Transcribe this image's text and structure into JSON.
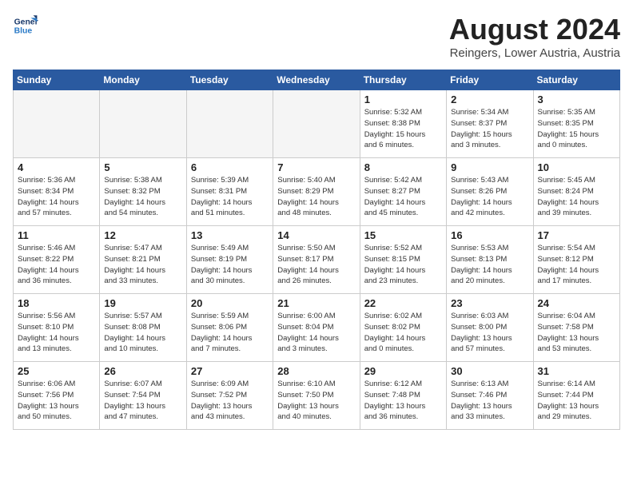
{
  "header": {
    "logo_line1": "General",
    "logo_line2": "Blue",
    "month": "August 2024",
    "location": "Reingers, Lower Austria, Austria"
  },
  "weekdays": [
    "Sunday",
    "Monday",
    "Tuesday",
    "Wednesday",
    "Thursday",
    "Friday",
    "Saturday"
  ],
  "weeks": [
    [
      {
        "num": "",
        "info": "",
        "empty": true
      },
      {
        "num": "",
        "info": "",
        "empty": true
      },
      {
        "num": "",
        "info": "",
        "empty": true
      },
      {
        "num": "",
        "info": "",
        "empty": true
      },
      {
        "num": "1",
        "info": "Sunrise: 5:32 AM\nSunset: 8:38 PM\nDaylight: 15 hours\nand 6 minutes."
      },
      {
        "num": "2",
        "info": "Sunrise: 5:34 AM\nSunset: 8:37 PM\nDaylight: 15 hours\nand 3 minutes."
      },
      {
        "num": "3",
        "info": "Sunrise: 5:35 AM\nSunset: 8:35 PM\nDaylight: 15 hours\nand 0 minutes."
      }
    ],
    [
      {
        "num": "4",
        "info": "Sunrise: 5:36 AM\nSunset: 8:34 PM\nDaylight: 14 hours\nand 57 minutes."
      },
      {
        "num": "5",
        "info": "Sunrise: 5:38 AM\nSunset: 8:32 PM\nDaylight: 14 hours\nand 54 minutes."
      },
      {
        "num": "6",
        "info": "Sunrise: 5:39 AM\nSunset: 8:31 PM\nDaylight: 14 hours\nand 51 minutes."
      },
      {
        "num": "7",
        "info": "Sunrise: 5:40 AM\nSunset: 8:29 PM\nDaylight: 14 hours\nand 48 minutes."
      },
      {
        "num": "8",
        "info": "Sunrise: 5:42 AM\nSunset: 8:27 PM\nDaylight: 14 hours\nand 45 minutes."
      },
      {
        "num": "9",
        "info": "Sunrise: 5:43 AM\nSunset: 8:26 PM\nDaylight: 14 hours\nand 42 minutes."
      },
      {
        "num": "10",
        "info": "Sunrise: 5:45 AM\nSunset: 8:24 PM\nDaylight: 14 hours\nand 39 minutes."
      }
    ],
    [
      {
        "num": "11",
        "info": "Sunrise: 5:46 AM\nSunset: 8:22 PM\nDaylight: 14 hours\nand 36 minutes."
      },
      {
        "num": "12",
        "info": "Sunrise: 5:47 AM\nSunset: 8:21 PM\nDaylight: 14 hours\nand 33 minutes."
      },
      {
        "num": "13",
        "info": "Sunrise: 5:49 AM\nSunset: 8:19 PM\nDaylight: 14 hours\nand 30 minutes."
      },
      {
        "num": "14",
        "info": "Sunrise: 5:50 AM\nSunset: 8:17 PM\nDaylight: 14 hours\nand 26 minutes."
      },
      {
        "num": "15",
        "info": "Sunrise: 5:52 AM\nSunset: 8:15 PM\nDaylight: 14 hours\nand 23 minutes."
      },
      {
        "num": "16",
        "info": "Sunrise: 5:53 AM\nSunset: 8:13 PM\nDaylight: 14 hours\nand 20 minutes."
      },
      {
        "num": "17",
        "info": "Sunrise: 5:54 AM\nSunset: 8:12 PM\nDaylight: 14 hours\nand 17 minutes."
      }
    ],
    [
      {
        "num": "18",
        "info": "Sunrise: 5:56 AM\nSunset: 8:10 PM\nDaylight: 14 hours\nand 13 minutes."
      },
      {
        "num": "19",
        "info": "Sunrise: 5:57 AM\nSunset: 8:08 PM\nDaylight: 14 hours\nand 10 minutes."
      },
      {
        "num": "20",
        "info": "Sunrise: 5:59 AM\nSunset: 8:06 PM\nDaylight: 14 hours\nand 7 minutes."
      },
      {
        "num": "21",
        "info": "Sunrise: 6:00 AM\nSunset: 8:04 PM\nDaylight: 14 hours\nand 3 minutes."
      },
      {
        "num": "22",
        "info": "Sunrise: 6:02 AM\nSunset: 8:02 PM\nDaylight: 14 hours\nand 0 minutes."
      },
      {
        "num": "23",
        "info": "Sunrise: 6:03 AM\nSunset: 8:00 PM\nDaylight: 13 hours\nand 57 minutes."
      },
      {
        "num": "24",
        "info": "Sunrise: 6:04 AM\nSunset: 7:58 PM\nDaylight: 13 hours\nand 53 minutes."
      }
    ],
    [
      {
        "num": "25",
        "info": "Sunrise: 6:06 AM\nSunset: 7:56 PM\nDaylight: 13 hours\nand 50 minutes."
      },
      {
        "num": "26",
        "info": "Sunrise: 6:07 AM\nSunset: 7:54 PM\nDaylight: 13 hours\nand 47 minutes."
      },
      {
        "num": "27",
        "info": "Sunrise: 6:09 AM\nSunset: 7:52 PM\nDaylight: 13 hours\nand 43 minutes."
      },
      {
        "num": "28",
        "info": "Sunrise: 6:10 AM\nSunset: 7:50 PM\nDaylight: 13 hours\nand 40 minutes."
      },
      {
        "num": "29",
        "info": "Sunrise: 6:12 AM\nSunset: 7:48 PM\nDaylight: 13 hours\nand 36 minutes."
      },
      {
        "num": "30",
        "info": "Sunrise: 6:13 AM\nSunset: 7:46 PM\nDaylight: 13 hours\nand 33 minutes."
      },
      {
        "num": "31",
        "info": "Sunrise: 6:14 AM\nSunset: 7:44 PM\nDaylight: 13 hours\nand 29 minutes."
      }
    ]
  ]
}
